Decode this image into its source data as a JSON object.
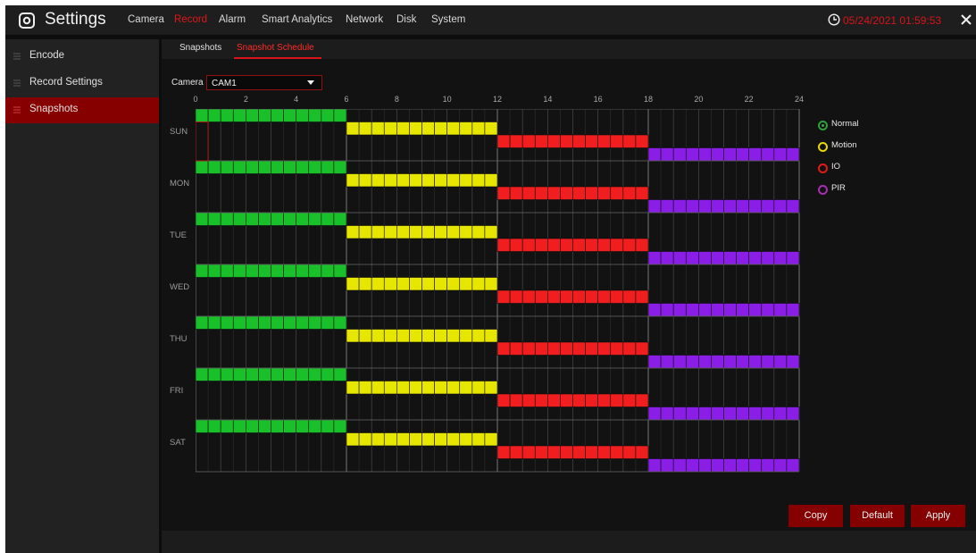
{
  "app": {
    "title": "Settings",
    "datetime": "05/24/2021 01:59:53"
  },
  "nav": [
    "Camera",
    "Record",
    "Alarm",
    "Smart Analytics",
    "Network",
    "Disk",
    "System"
  ],
  "nav_active": "Record",
  "sidebar": {
    "items": [
      {
        "label": "Encode",
        "active": false
      },
      {
        "label": "Record Settings",
        "active": false
      },
      {
        "label": "Snapshots",
        "active": true
      }
    ]
  },
  "subtabs": [
    {
      "label": "Snapshots",
      "active": false
    },
    {
      "label": "Snapshot Schedule",
      "active": true
    }
  ],
  "camera": {
    "label": "Camera",
    "value": "CAM1"
  },
  "schedule": {
    "hours": [
      "0",
      "2",
      "4",
      "6",
      "8",
      "10",
      "12",
      "14",
      "16",
      "18",
      "20",
      "22",
      "24"
    ],
    "days": [
      "SUN",
      "MON",
      "TUE",
      "WED",
      "THU",
      "FRI",
      "SAT"
    ],
    "blocks": [
      {
        "type": "Normal",
        "start": 0,
        "end": 6,
        "color": "#19c029"
      },
      {
        "type": "Motion",
        "start": 6,
        "end": 12,
        "color": "#e6e600"
      },
      {
        "type": "IO",
        "start": 12,
        "end": 18,
        "color": "#f01e1e"
      },
      {
        "type": "PIR",
        "start": 18,
        "end": 24,
        "color": "#8a1ee6"
      }
    ]
  },
  "legend": [
    {
      "label": "Normal",
      "color": "#2f9f3f",
      "selected": true
    },
    {
      "label": "Motion",
      "color": "#e8d800",
      "selected": false
    },
    {
      "label": "IO",
      "color": "#e01b1b",
      "selected": false
    },
    {
      "label": "PIR",
      "color": "#a52fb0",
      "selected": false
    }
  ],
  "buttons": {
    "copy": "Copy",
    "default": "Default",
    "apply": "Apply"
  }
}
